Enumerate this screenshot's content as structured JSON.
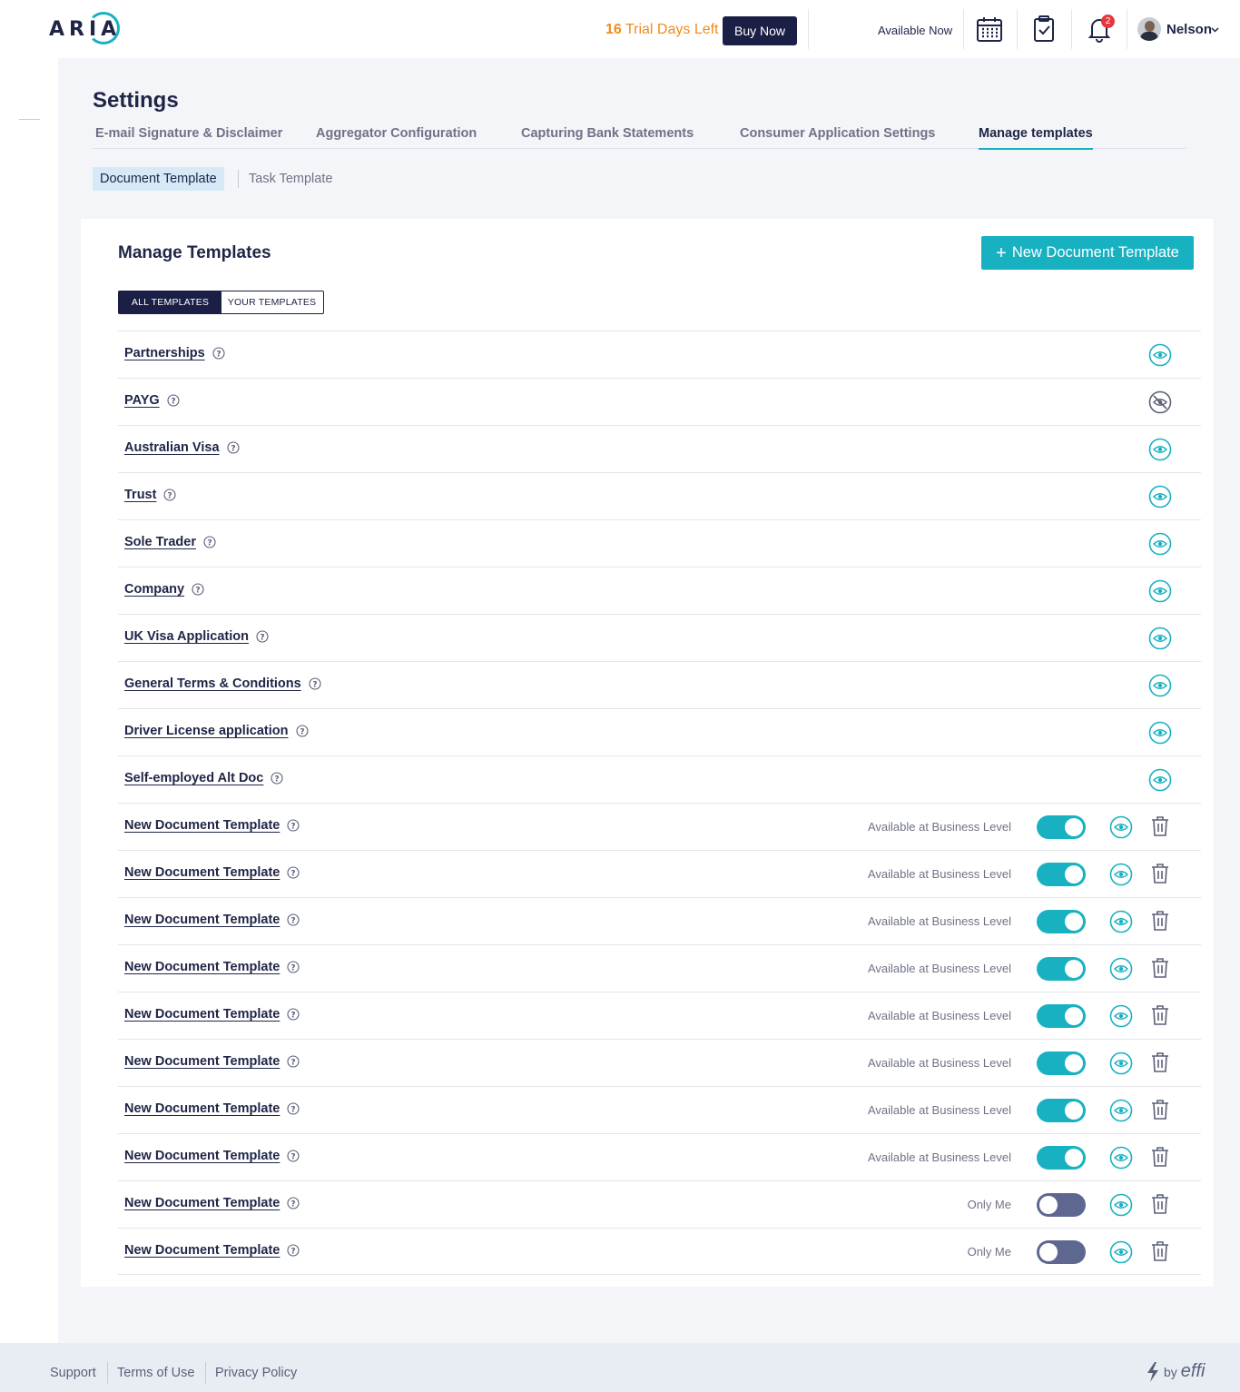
{
  "header": {
    "logo": "ARIA",
    "trial_days": "16",
    "trial_text": "Trial Days Left",
    "buy_label": "Buy Now",
    "availability": "Available Now",
    "notification_count": "2",
    "user_name": "Nelson"
  },
  "settings": {
    "title": "Settings",
    "tabs": [
      {
        "label": "E-mail Signature & Disclaimer",
        "active": false
      },
      {
        "label": "Aggregator Configuration",
        "active": false
      },
      {
        "label": "Capturing Bank Statements",
        "active": false
      },
      {
        "label": "Consumer Application Settings",
        "active": false
      },
      {
        "label": "Manage templates",
        "active": true
      }
    ],
    "subtabs": [
      "Document Template",
      "Task Template"
    ]
  },
  "card": {
    "title": "Manage Templates",
    "new_button_label": "New Document Template",
    "filters": [
      "All Templates",
      "Your Templates"
    ]
  },
  "templates": [
    {
      "name": "Partnerships",
      "kind": "system",
      "visible": true
    },
    {
      "name": "PAYG",
      "kind": "system",
      "visible": false
    },
    {
      "name": "Australian Visa",
      "kind": "system",
      "visible": true
    },
    {
      "name": "Trust",
      "kind": "system",
      "visible": true
    },
    {
      "name": "Sole Trader",
      "kind": "system",
      "visible": true
    },
    {
      "name": "Company",
      "kind": "system",
      "visible": true
    },
    {
      "name": "UK Visa Application",
      "kind": "system",
      "visible": true
    },
    {
      "name": "General Terms & Conditions",
      "kind": "system",
      "visible": true
    },
    {
      "name": "Driver License application",
      "kind": "system",
      "visible": true
    },
    {
      "name": "Self-employed Alt Doc",
      "kind": "system",
      "visible": true
    },
    {
      "name": "New Document Template",
      "kind": "custom",
      "availability": "Available at Business Level",
      "toggle_on": true
    },
    {
      "name": "New Document Template",
      "kind": "custom",
      "availability": "Available at Business Level",
      "toggle_on": true
    },
    {
      "name": "New Document Template",
      "kind": "custom",
      "availability": "Available at Business Level",
      "toggle_on": true
    },
    {
      "name": "New Document Template",
      "kind": "custom",
      "availability": "Available at Business Level",
      "toggle_on": true
    },
    {
      "name": "New Document Template",
      "kind": "custom",
      "availability": "Available at Business Level",
      "toggle_on": true
    },
    {
      "name": "New Document Template",
      "kind": "custom",
      "availability": "Available at Business Level",
      "toggle_on": true
    },
    {
      "name": "New Document Template",
      "kind": "custom",
      "availability": "Available at Business Level",
      "toggle_on": true
    },
    {
      "name": "New Document Template",
      "kind": "custom",
      "availability": "Available at Business Level",
      "toggle_on": true
    },
    {
      "name": "New Document Template",
      "kind": "custom",
      "availability": "Only Me",
      "toggle_on": false
    },
    {
      "name": "New Document Template",
      "kind": "custom",
      "availability": "Only Me",
      "toggle_on": false
    }
  ],
  "footer": {
    "links": [
      "Support",
      "Terms of Use",
      "Privacy Policy"
    ],
    "brand_by": "by",
    "brand_name": "effi"
  },
  "colors": {
    "accent": "#17b1c1",
    "navy": "#1b1f45",
    "trial": "#f28b1a",
    "badge": "#e6373d"
  }
}
